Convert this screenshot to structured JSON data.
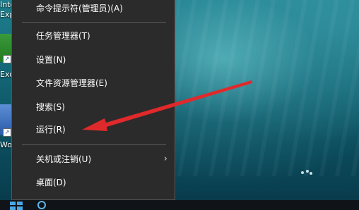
{
  "desktop": {
    "icons": [
      {
        "label_line1": "Inte",
        "label_line2": "Exp"
      },
      {
        "label": "Exce",
        "icon": "excel-icon"
      },
      {
        "label": "Wo",
        "icon": "word-icon"
      }
    ]
  },
  "context_menu": {
    "items": [
      {
        "label": "命令提示符(管理员)(A)"
      },
      {
        "label": "任务管理器(T)"
      },
      {
        "label": "设置(N)"
      },
      {
        "label": "文件资源管理器(E)"
      },
      {
        "label": "搜索(S)"
      },
      {
        "label": "运行(R)"
      },
      {
        "label": "关机或注销(U)",
        "submenu": true
      },
      {
        "label": "桌面(D)"
      }
    ],
    "submenu_glyph": "›"
  },
  "annotation": {
    "icon": "arrow-annotation",
    "color": "#e0292b"
  },
  "taskbar": {
    "start_icon": "windows-start-icon",
    "search_icon": "cortana-icon"
  }
}
